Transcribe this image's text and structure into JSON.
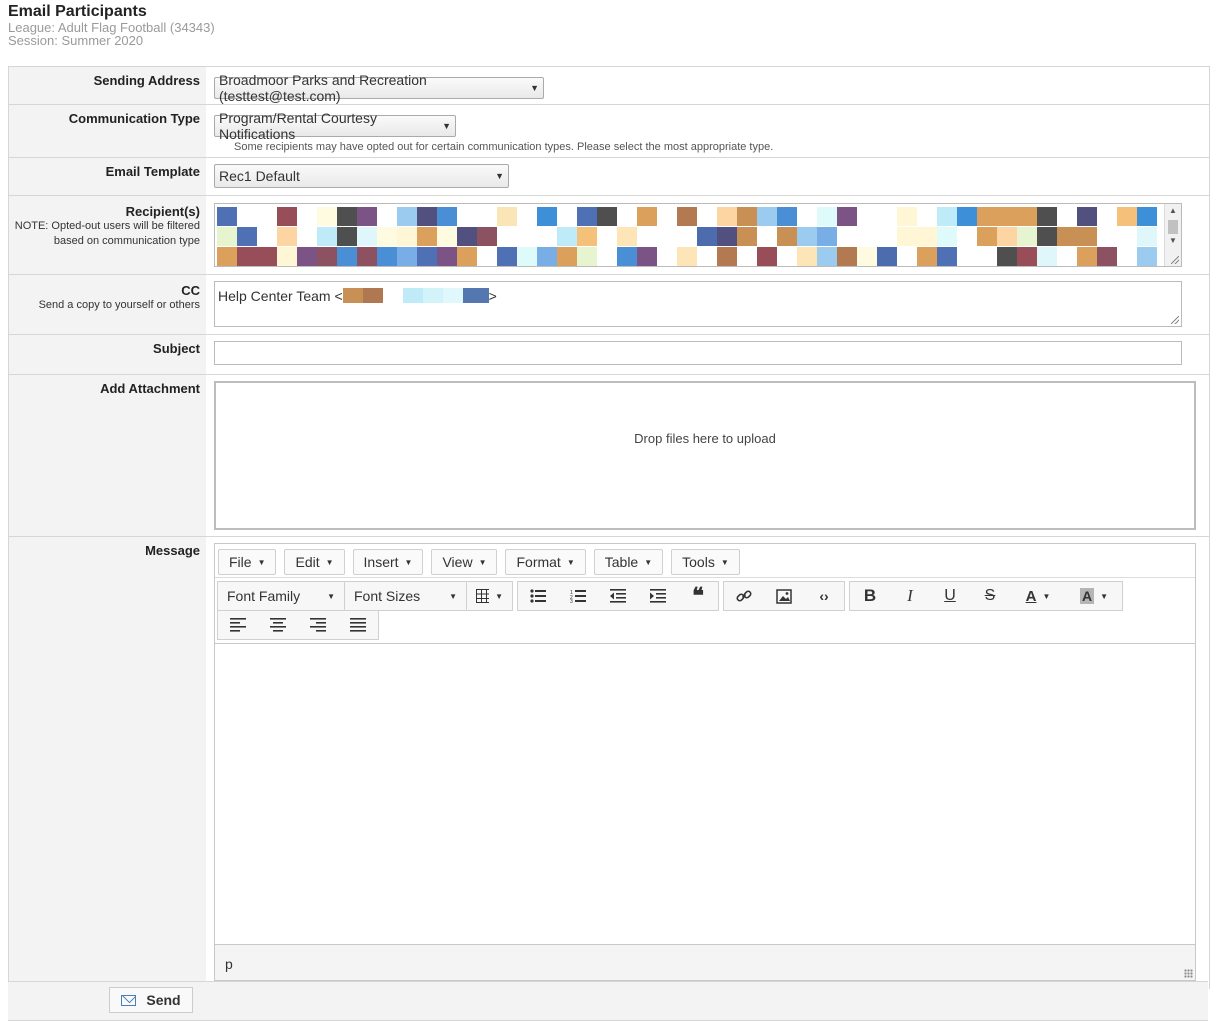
{
  "page": {
    "title": "Email Participants",
    "league": "League: Adult Flag Football (34343)",
    "session": "Session: Summer 2020"
  },
  "form": {
    "sending_address": {
      "label": "Sending Address",
      "value": "Broadmoor Parks and Recreation (testtest@test.com)"
    },
    "communication_type": {
      "label": "Communication Type",
      "value": "Program/Rental Courtesy Notifications",
      "help": "Some recipients may have opted out for certain communication types. Please select the most appropriate type."
    },
    "email_template": {
      "label": "Email Template",
      "value": "Rec1 Default"
    },
    "recipients": {
      "label": "Recipient(s)",
      "note": "NOTE: Opted-out users will be filtered based on communication type"
    },
    "cc": {
      "label": "CC",
      "note": "Send a copy to yourself or others",
      "value_prefix": "Help Center Team <",
      "value_suffix": ">"
    },
    "subject": {
      "label": "Subject",
      "value": ""
    },
    "attachment": {
      "label": "Add Attachment",
      "dropzone_text": "Drop files here to upload"
    },
    "message": {
      "label": "Message"
    }
  },
  "editor": {
    "menus": [
      "File",
      "Edit",
      "Insert",
      "View",
      "Format",
      "Table",
      "Tools"
    ],
    "font_family": "Font Family",
    "font_sizes": "Font Sizes",
    "status_path": "p"
  },
  "footer": {
    "send_label": "Send"
  },
  "colors": {
    "label_bg": "#f3f3f3",
    "border": "#d6d6d6",
    "icon_blue": "#4a7fb5"
  }
}
